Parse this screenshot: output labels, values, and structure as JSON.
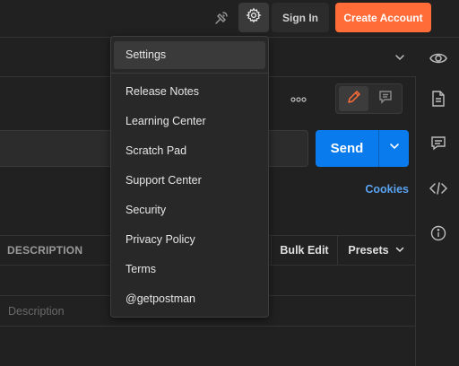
{
  "header": {
    "sign_in_label": "Sign In",
    "create_account_label": "Create Account",
    "icons": [
      "satellite-icon",
      "gear-icon"
    ],
    "accent_color": "#ff6c37"
  },
  "tab_row": {
    "icons": [
      "chevron-down-icon",
      "eye-icon"
    ]
  },
  "request": {
    "send_label": "Send",
    "send_color": "#097bed",
    "cookies_label": "Cookies",
    "icons": [
      "more-dots-icon",
      "pencil-icon",
      "comment-icon",
      "chevron-down-icon"
    ]
  },
  "params_table": {
    "header_description": "DESCRIPTION",
    "bulk_edit_label": "Bulk Edit",
    "presets_label": "Presets",
    "description_placeholder": "Description"
  },
  "right_sidebar": {
    "icons": [
      "document-icon",
      "comment-icon",
      "code-icon",
      "info-icon"
    ]
  },
  "settings_menu": {
    "items": [
      {
        "label": "Settings"
      },
      {
        "label": "Release Notes"
      },
      {
        "label": "Learning Center"
      },
      {
        "label": "Scratch Pad"
      },
      {
        "label": "Support Center"
      },
      {
        "label": "Security"
      },
      {
        "label": "Privacy Policy"
      },
      {
        "label": "Terms"
      },
      {
        "label": "@getpostman"
      }
    ]
  }
}
